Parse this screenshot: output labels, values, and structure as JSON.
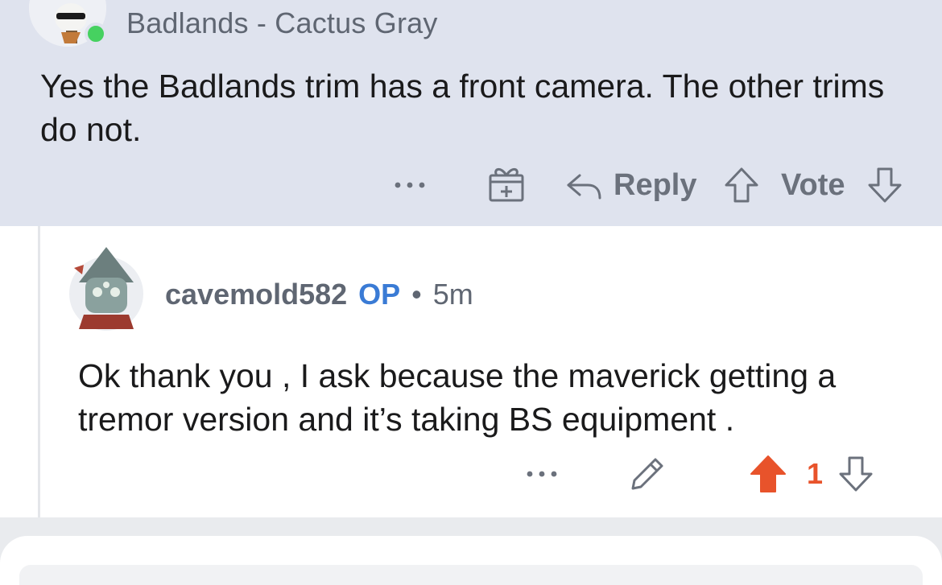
{
  "comment": {
    "flair": "Badlands - Cactus Gray",
    "body": "Yes the Badlands trim has a front camera. The other trims do not.",
    "actions": {
      "more": "•••",
      "reply_label": "Reply",
      "vote_label": "Vote"
    }
  },
  "reply": {
    "username": "cavemold582",
    "op_badge": "OP",
    "separator": "•",
    "time": "5m",
    "body": "Ok thank you , I ask because the maverick getting a tremor version and it’s taking BS equipment .",
    "actions": {
      "more": "•••",
      "vote_count": "1",
      "upvoted": true
    }
  },
  "colors": {
    "highlight_bg": "#dfe3ee",
    "upvote_orange": "#e8532b",
    "op_blue": "#3a7bd5",
    "online_green": "#46d160",
    "meta_gray": "#5f6672"
  },
  "icons": {
    "top": [
      "more-icon",
      "award-gift-icon",
      "reply-arrow-icon",
      "upvote-outline-icon",
      "downvote-outline-icon"
    ],
    "reply": [
      "more-icon",
      "edit-pencil-icon",
      "upvote-filled-icon",
      "downvote-outline-icon"
    ],
    "status": "online-status-dot"
  }
}
